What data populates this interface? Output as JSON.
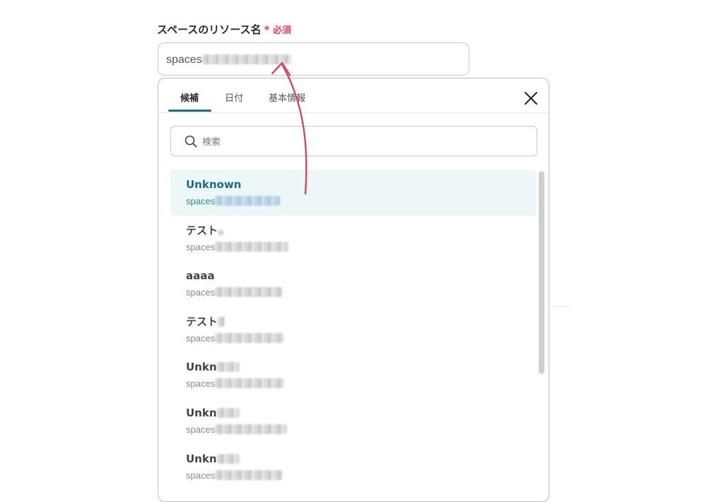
{
  "field": {
    "label": "スペースのリソース名",
    "required_mark": "*",
    "required_text": "必須",
    "value_prefix": "spaces"
  },
  "dropdown": {
    "tabs": [
      {
        "label": "候補"
      },
      {
        "label": "日付"
      },
      {
        "label": "基本情報"
      }
    ],
    "search_placeholder": "検索",
    "items": [
      {
        "name": "Unknown",
        "id": "spaces"
      },
      {
        "name": "テスト",
        "id": "spaces"
      },
      {
        "name": "aaaa",
        "id": "spaces"
      },
      {
        "name": "テスト",
        "id": "spaces"
      },
      {
        "name": "Unkn",
        "id": "spaces"
      },
      {
        "name": "Unkn",
        "id": "spaces"
      },
      {
        "name": "Unkn",
        "id": "spaces"
      }
    ]
  },
  "colors": {
    "accent": "#1d6b85",
    "required": "#e0435a",
    "arrow": "#d24a5a",
    "selected_bg": "#eef7f8"
  },
  "icons": {
    "close": "close-icon",
    "search": "search-icon"
  }
}
